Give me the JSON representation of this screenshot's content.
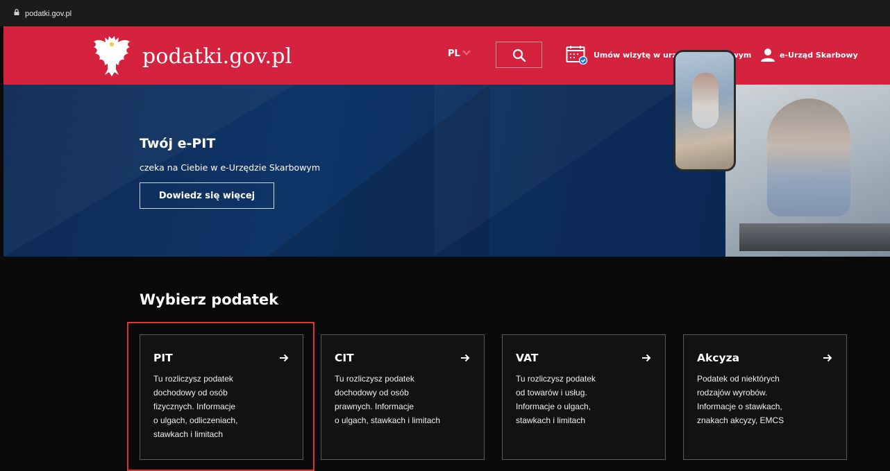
{
  "browser": {
    "url": "podatki.gov.pl"
  },
  "header": {
    "logo_text": "podatki.gov.pl",
    "language": "PL",
    "appointment_label": "Umów wizytę w urzędzie skarbowym",
    "eurzad_label": "e-Urząd Skarbowy",
    "brand_color": "#d5233f"
  },
  "hero": {
    "title": "Twój e-PIT",
    "subtitle": "czeka na Ciebie w e-Urzędzie Skarbowym",
    "button_label": "Dowiedz się więcej"
  },
  "taxes": {
    "title": "Wybierz podatek",
    "cards": [
      {
        "title": "PIT",
        "description": "Tu rozliczysz podatek\ndochodowy od osób\nfizycznych. Informacje\no ulgach, odliczeniach,\nstawkach i limitach",
        "highlighted": true
      },
      {
        "title": "CIT",
        "description": "Tu rozliczysz podatek\ndochodowy od osób\nprawnych. Informacje\no ulgach, stawkach i limitach",
        "highlighted": false
      },
      {
        "title": "VAT",
        "description": "Tu rozliczysz podatek\nod towarów i usług.\nInformacje o ulgach,\nstawkach i limitach",
        "highlighted": false
      },
      {
        "title": "Akcyza",
        "description": "Podatek od niektórych\nrodzajów wyrobów.\nInformacje o stawkach,\nznakach akcyzy, EMCS",
        "highlighted": false
      }
    ],
    "highlight_color": "#e0352b"
  }
}
